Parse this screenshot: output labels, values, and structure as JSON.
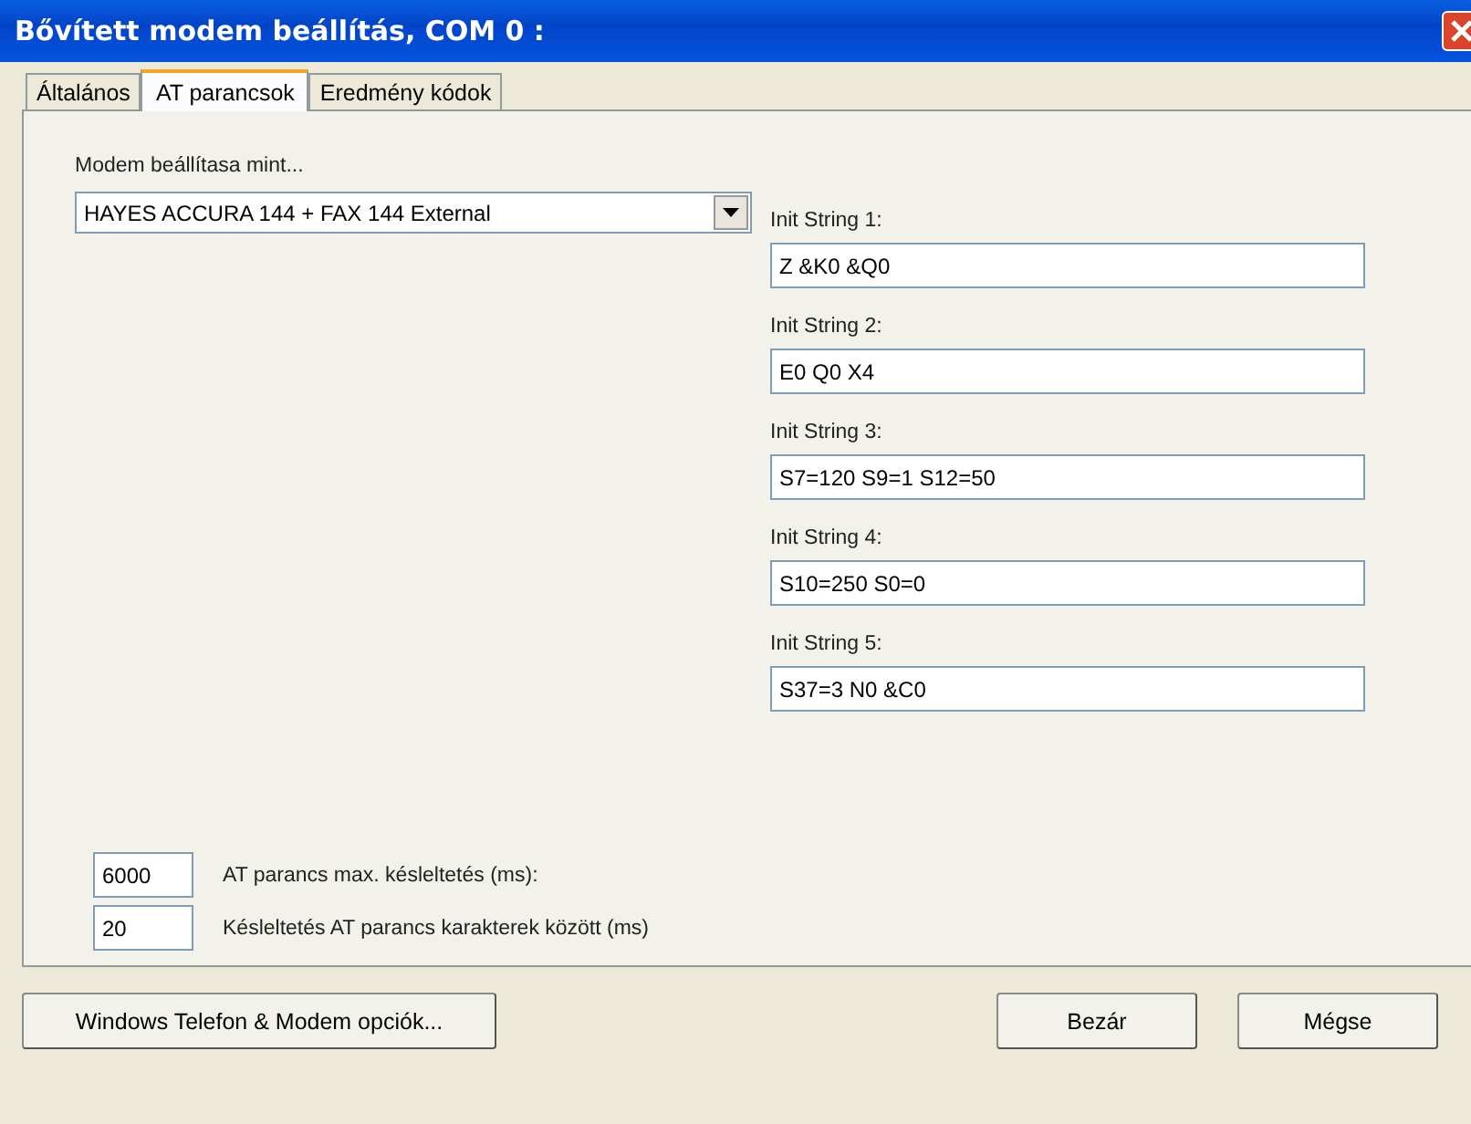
{
  "window": {
    "title": "Bővített modem beállítás, COM 0 :"
  },
  "tabs": [
    {
      "label": "Általános",
      "selected": false
    },
    {
      "label": "AT parancsok",
      "selected": true
    },
    {
      "label": "Eredmény kódok",
      "selected": false
    }
  ],
  "modem": {
    "label": "Modem beállítasa mint...",
    "value": "HAYES ACCURA 144 + FAX 144 External"
  },
  "init_strings": [
    {
      "label": "Init String 1:",
      "value": "Z &K0 &Q0"
    },
    {
      "label": "Init String 2:",
      "value": "E0 Q0 X4"
    },
    {
      "label": "Init String 3:",
      "value": "S7=120 S9=1 S12=50"
    },
    {
      "label": "Init String 4:",
      "value": "S10=250 S0=0"
    },
    {
      "label": "Init String 5:",
      "value": "S37=3 N0 &C0"
    }
  ],
  "delays": [
    {
      "value": "6000",
      "label": "AT parancs max. késleltetés (ms):"
    },
    {
      "value": "20",
      "label": "Késleltetés AT parancs karakterek között (ms)"
    }
  ],
  "buttons": {
    "left": "Windows Telefon & Modem opciók...",
    "right": [
      "Bezár",
      "Mégse"
    ]
  }
}
